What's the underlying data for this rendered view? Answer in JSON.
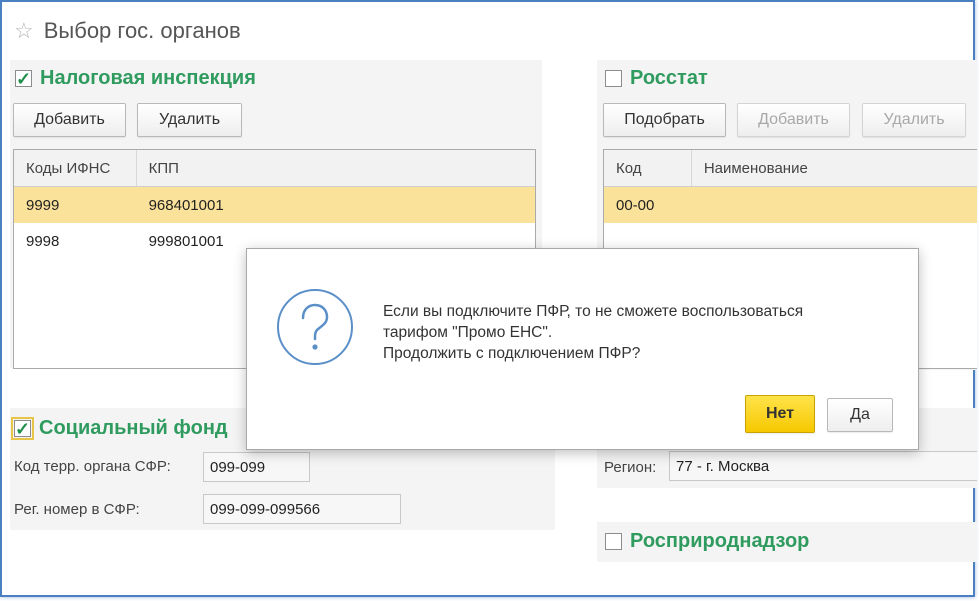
{
  "window": {
    "title": "Выбор гос. органов"
  },
  "tax": {
    "title": "Налоговая инспекция",
    "checked": true,
    "add_label": "Добавить",
    "delete_label": "Удалить",
    "columns": [
      "Коды ИФНС",
      "КПП"
    ],
    "rows": [
      {
        "code": "9999",
        "kpp": "968401001",
        "selected": true
      },
      {
        "code": "9998",
        "kpp": "999801001",
        "selected": false
      }
    ]
  },
  "rosstat": {
    "title": "Росстат",
    "checked": false,
    "pick_label": "Подобрать",
    "add_label": "Добавить",
    "delete_label": "Удалить",
    "columns": [
      "Код",
      "Наименование"
    ],
    "rows": [
      {
        "code": "00-00",
        "name": ""
      }
    ]
  },
  "sfr": {
    "title": "Социальный фонд",
    "checked": true,
    "terr_label": "Код терр. органа СФР:",
    "terr_value": "099-099",
    "reg_label": "Рег. номер в СФР:",
    "reg_value": "099-099-099566"
  },
  "region": {
    "label": "Регион:",
    "value": "77 - г. Москва"
  },
  "rpn": {
    "title": "Росприроднадзор",
    "checked": false
  },
  "dialog": {
    "icon": "question-icon",
    "lines": [
      "Если вы подключите ПФР, то не сможете воспользоваться",
      "тарифом \"Промо ЕНС\".",
      "Продолжить с подключением ПФР?"
    ],
    "no_label": "Нет",
    "yes_label": "Да"
  }
}
